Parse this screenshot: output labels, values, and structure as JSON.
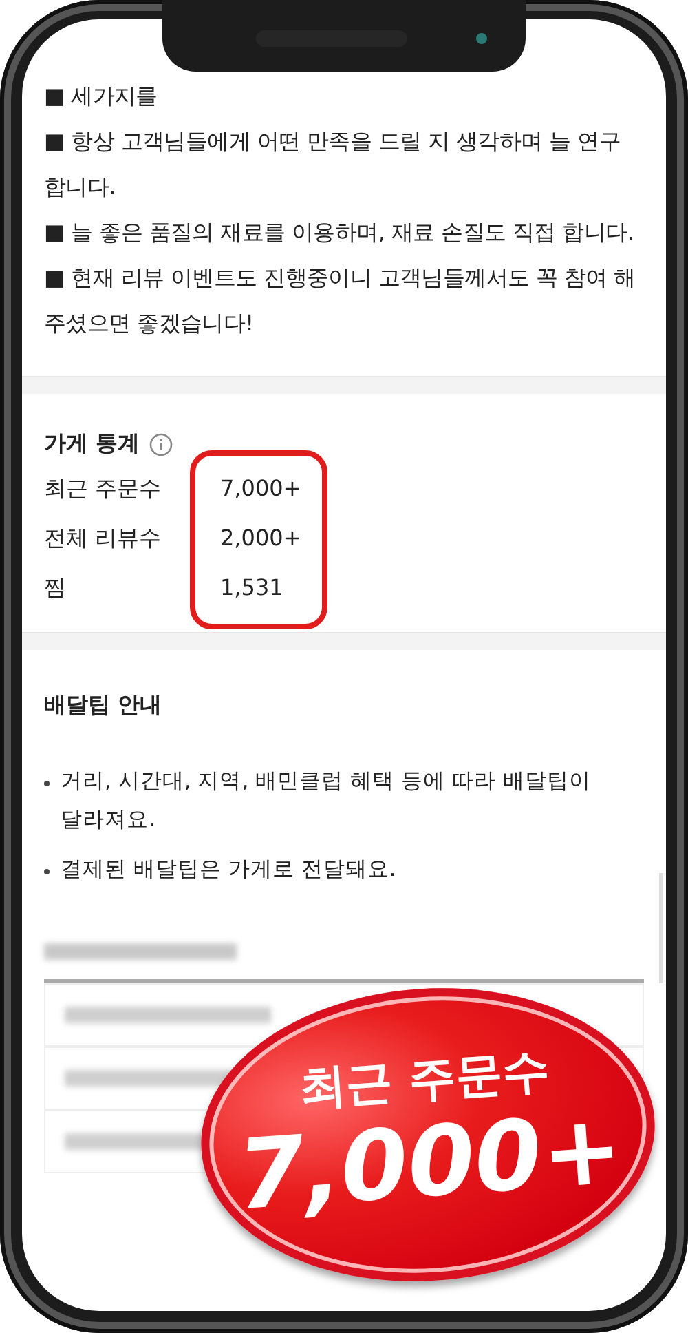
{
  "intro_lines": [
    "■ 세가지를",
    "■ 항상 고객님들에게 어떤 만족을 드릴 지 생각하며 늘 연구합니다.",
    "■ 늘 좋은 품질의 재료를 이용하며, 재료 손질도 직접 합니다.",
    "■ 현재 리뷰 이벤트도 진행중이니 고객님들께서도 꼭 참여 해주셨으면 좋겠습니다!"
  ],
  "store_stats": {
    "title": "가게 통계",
    "rows": [
      {
        "label": "최근 주문수",
        "value": "7,000+"
      },
      {
        "label": "전체 리뷰수",
        "value": "2,000+"
      },
      {
        "label": "찜",
        "value": "1,531"
      }
    ]
  },
  "delivery_tip": {
    "title": "배달팁 안내",
    "bullets": [
      "거리, 시간대, 지역, 배민클럽 혜택 등에 따라 배달팁이 달라져요.",
      "결제된 배달팁은 가게로 전달돼요."
    ]
  },
  "badge": {
    "label": "최근 주문수",
    "value": "7,000+"
  }
}
